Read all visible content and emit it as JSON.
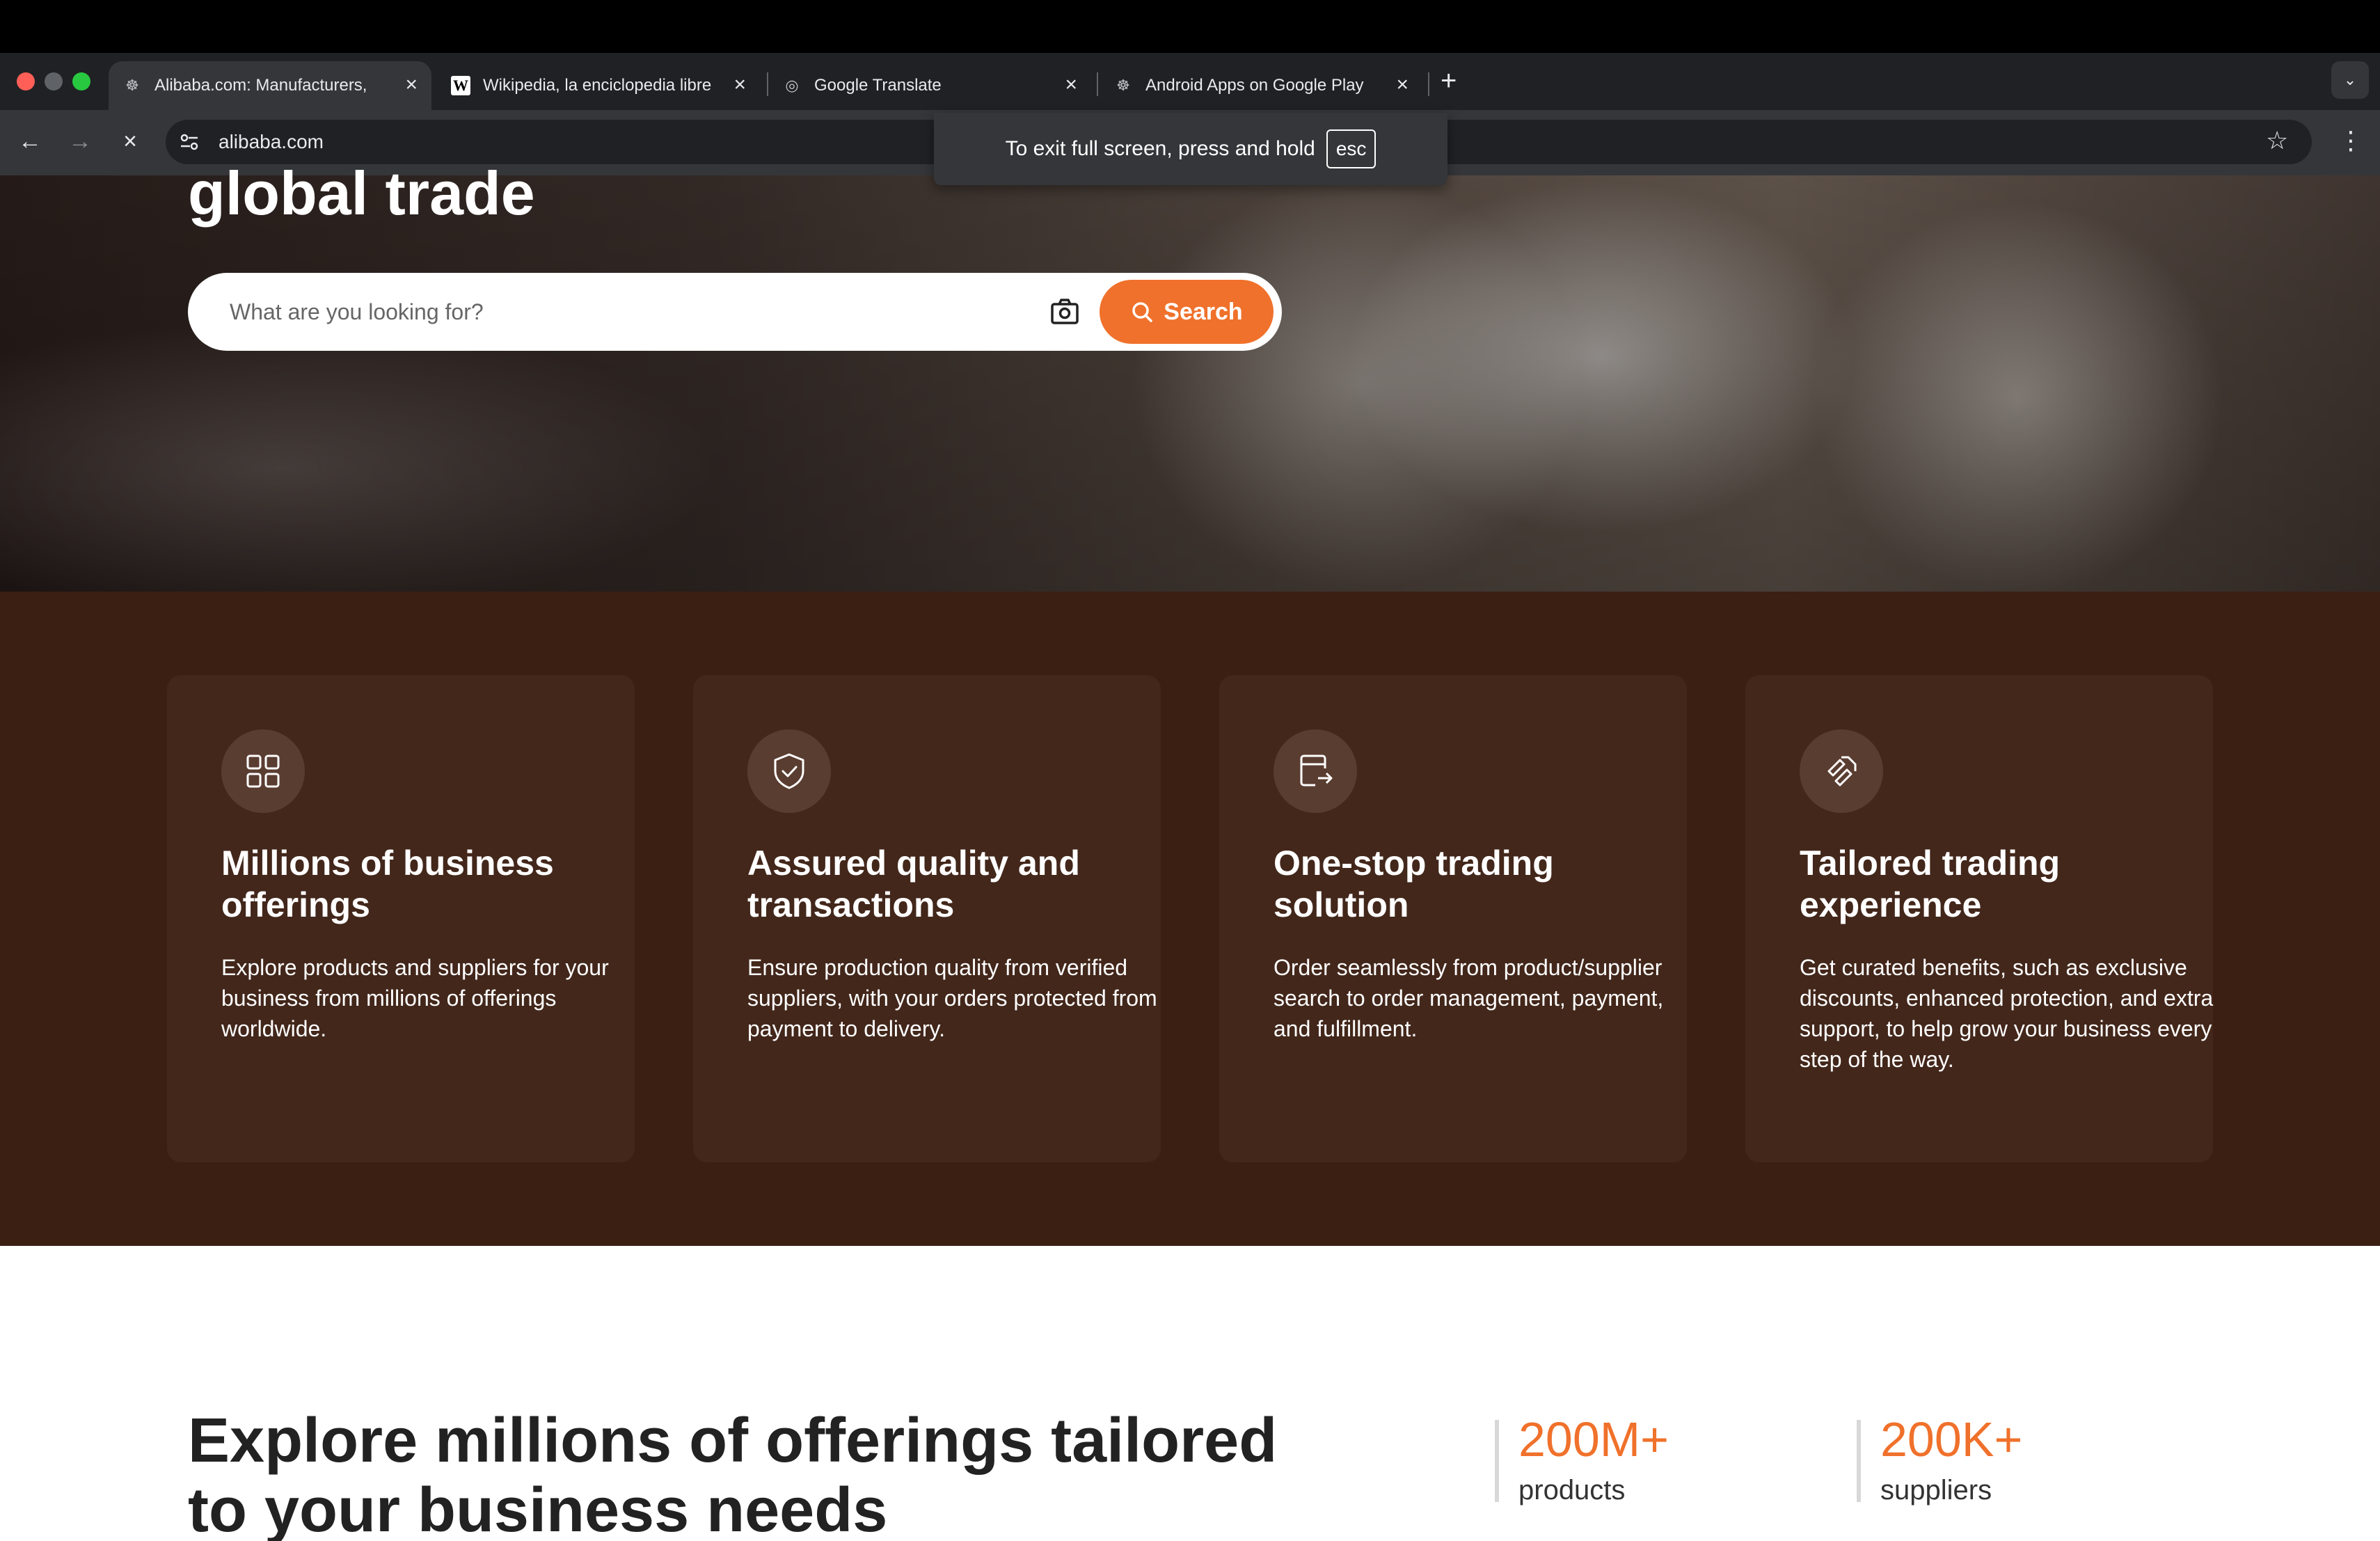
{
  "browser": {
    "tabs": [
      {
        "title": "Alibaba.com: Manufacturers,",
        "active": true,
        "favicon": "alibaba-icon"
      },
      {
        "title": "Wikipedia, la enciclopedia libre",
        "active": false,
        "favicon": "W"
      },
      {
        "title": "Google Translate",
        "active": false,
        "favicon": "globe-icon"
      },
      {
        "title": "Android Apps on Google Play",
        "active": false,
        "favicon": "alibaba-icon"
      }
    ],
    "url": "alibaba.com",
    "fullscreen_notice": "To exit full screen, press and hold",
    "fullscreen_key": "esc",
    "colors": {
      "tabstrip": "#202124",
      "toolbar": "#35363a"
    }
  },
  "hero": {
    "title": "global trade",
    "search_placeholder": "What are you looking for?",
    "search_button": "Search",
    "accent": "#f0712b"
  },
  "features": {
    "background": "#3b1f13",
    "cards": [
      {
        "icon": "grid-icon",
        "title": "Millions of business offerings",
        "text": "Explore products and suppliers for your business from millions of offerings worldwide."
      },
      {
        "icon": "shield-check-icon",
        "title": "Assured quality and transactions",
        "text": "Ensure production quality from verified suppliers, with your orders protected from payment to delivery."
      },
      {
        "icon": "order-transfer-icon",
        "title": "One-stop trading solution",
        "text": "Order seamlessly from product/supplier search to order management, payment, and fulfillment."
      },
      {
        "icon": "tailored-icon",
        "title": "Tailored trading experience",
        "text": "Get curated benefits, such as exclusive discounts, enhanced protection, and extra support, to help grow your business every step of the way."
      }
    ]
  },
  "explore": {
    "title": "Explore millions of offerings tailored to your business needs",
    "stats": [
      {
        "value": "200M+",
        "label": "products"
      },
      {
        "value": "200K+",
        "label": "suppliers"
      }
    ]
  }
}
